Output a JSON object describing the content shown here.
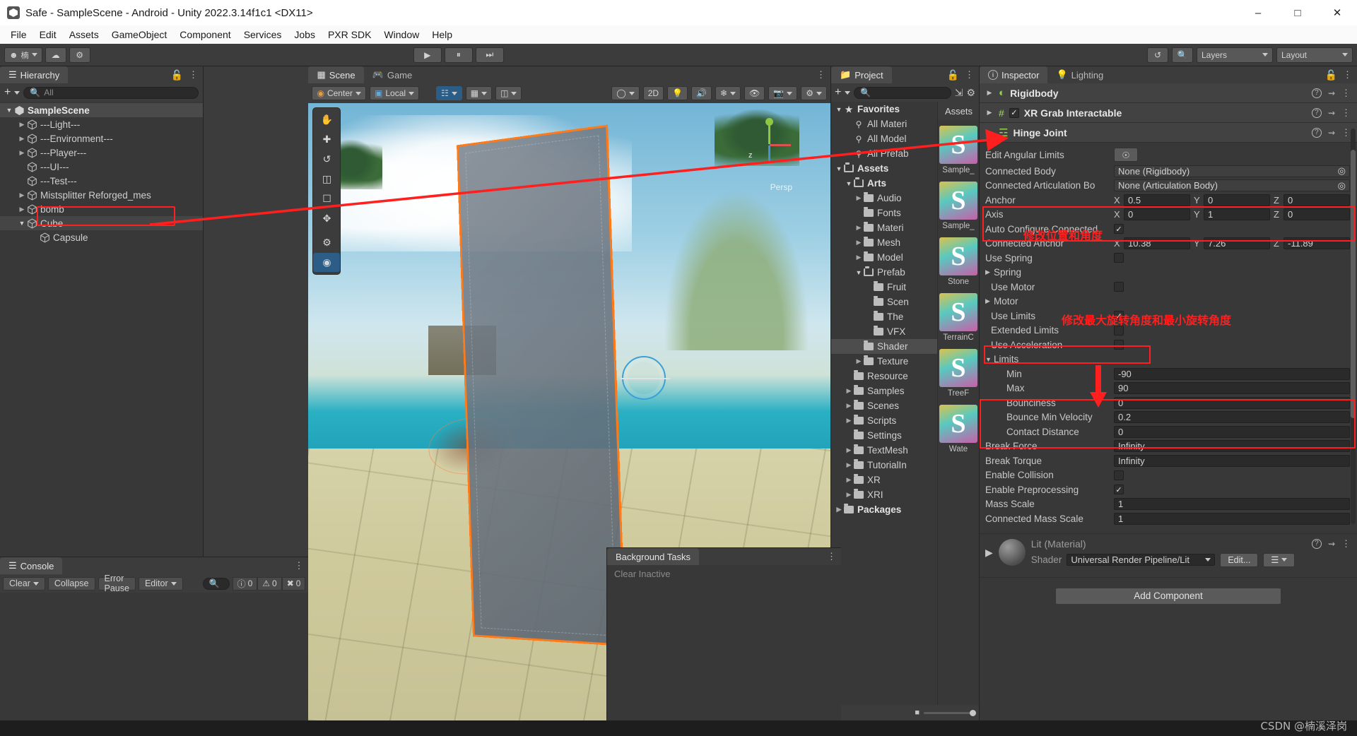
{
  "window": {
    "title": "Safe - SampleScene - Android - Unity 2022.3.14f1c1 <DX11>",
    "minimize": "–",
    "maximize": "□",
    "close": "✕"
  },
  "menubar": [
    "File",
    "Edit",
    "Assets",
    "GameObject",
    "Component",
    "Services",
    "Jobs",
    "PXR SDK",
    "Window",
    "Help"
  ],
  "toolbar": {
    "account_icon": "account-icon",
    "cloud_icon": "cloud-icon",
    "settings_icon": "gear-icon",
    "play": "▶",
    "pause": "⏸",
    "step": "⏭",
    "history_icon": "undo-history-icon",
    "search_icon": "search-icon",
    "layers_label": "Layers",
    "layout_label": "Layout"
  },
  "hierarchy": {
    "tab": "Hierarchy",
    "search_placeholder": "All",
    "items": [
      {
        "label": "SampleScene",
        "depth": 0,
        "arrow": "down",
        "icon": "unity-scene-icon",
        "selected": false,
        "scene": true
      },
      {
        "label": "---Light---",
        "depth": 1,
        "arrow": "right",
        "icon": "gameobject-icon",
        "selected": false
      },
      {
        "label": "---Environment---",
        "depth": 1,
        "arrow": "right",
        "icon": "gameobject-icon",
        "selected": false
      },
      {
        "label": "---Player---",
        "depth": 1,
        "arrow": "right",
        "icon": "gameobject-icon",
        "selected": false
      },
      {
        "label": "---UI---",
        "depth": 1,
        "arrow": "",
        "icon": "gameobject-icon",
        "selected": false
      },
      {
        "label": "---Test---",
        "depth": 1,
        "arrow": "",
        "icon": "gameobject-icon",
        "selected": false
      },
      {
        "label": "Mistsplitter Reforged_mes",
        "depth": 1,
        "arrow": "right",
        "icon": "gameobject-icon",
        "selected": false
      },
      {
        "label": "bomb",
        "depth": 1,
        "arrow": "right",
        "icon": "gameobject-icon",
        "selected": false
      },
      {
        "label": "Cube",
        "depth": 1,
        "arrow": "down",
        "icon": "gameobject-icon",
        "selected": true
      },
      {
        "label": "Capsule",
        "depth": 2,
        "arrow": "",
        "icon": "gameobject-icon",
        "selected": false
      }
    ]
  },
  "scene": {
    "tabs": [
      {
        "label": "Scene",
        "icon": "scene-icon",
        "active": true
      },
      {
        "label": "Game",
        "icon": "game-icon",
        "active": false
      }
    ],
    "pivot_label": "Center",
    "space_label": "Local",
    "mode_2d": "2D",
    "perspective_label": "Persp",
    "axis_x": "x",
    "axis_y": "y",
    "axis_z": "z",
    "tools": [
      "hand-tool",
      "move-tool",
      "rotate-tool",
      "scale-tool",
      "rect-tool",
      "transform-tool",
      "custom-tool",
      "collider-tool"
    ]
  },
  "console": {
    "tab": "Console",
    "clear": "Clear",
    "collapse": "Collapse",
    "error_pause": "Error Pause",
    "editor": "Editor",
    "search_placeholder": "",
    "log_count": "0",
    "warn_count": "0",
    "error_count": "0"
  },
  "background_tasks": {
    "title": "Background Tasks",
    "clear_inactive": "Clear Inactive"
  },
  "project": {
    "tab": "Project",
    "search_placeholder": "",
    "assets_column_header": "Assets",
    "tree": [
      {
        "label": "Favorites",
        "depth": 0,
        "arrow": "down",
        "icon": "star-icon",
        "bold": true
      },
      {
        "label": "All Materi",
        "depth": 1,
        "arrow": "",
        "icon": "search-icon"
      },
      {
        "label": "All Model",
        "depth": 1,
        "arrow": "",
        "icon": "search-icon"
      },
      {
        "label": "All Prefab",
        "depth": 1,
        "arrow": "",
        "icon": "search-icon"
      },
      {
        "label": "Assets",
        "depth": 0,
        "arrow": "down",
        "icon": "folder-open-icon",
        "bold": true
      },
      {
        "label": "Arts",
        "depth": 1,
        "arrow": "down",
        "icon": "folder-open-icon",
        "bold": true
      },
      {
        "label": "Audio",
        "depth": 2,
        "arrow": "right",
        "icon": "folder-icon"
      },
      {
        "label": "Fonts",
        "depth": 2,
        "arrow": "",
        "icon": "folder-icon"
      },
      {
        "label": "Materi",
        "depth": 2,
        "arrow": "right",
        "icon": "folder-icon"
      },
      {
        "label": "Mesh",
        "depth": 2,
        "arrow": "right",
        "icon": "folder-icon"
      },
      {
        "label": "Model",
        "depth": 2,
        "arrow": "right",
        "icon": "folder-icon"
      },
      {
        "label": "Prefab",
        "depth": 2,
        "arrow": "down",
        "icon": "folder-open-icon"
      },
      {
        "label": "Fruit",
        "depth": 3,
        "arrow": "",
        "icon": "folder-icon"
      },
      {
        "label": "Scen",
        "depth": 3,
        "arrow": "",
        "icon": "folder-icon"
      },
      {
        "label": "The",
        "depth": 3,
        "arrow": "",
        "icon": "folder-icon"
      },
      {
        "label": "VFX",
        "depth": 3,
        "arrow": "",
        "icon": "folder-icon"
      },
      {
        "label": "Shader",
        "depth": 2,
        "arrow": "",
        "icon": "folder-icon",
        "selected": true
      },
      {
        "label": "Texture",
        "depth": 2,
        "arrow": "right",
        "icon": "folder-icon"
      },
      {
        "label": "Resource",
        "depth": 1,
        "arrow": "",
        "icon": "folder-icon"
      },
      {
        "label": "Samples",
        "depth": 1,
        "arrow": "right",
        "icon": "folder-icon"
      },
      {
        "label": "Scenes",
        "depth": 1,
        "arrow": "right",
        "icon": "folder-icon"
      },
      {
        "label": "Scripts",
        "depth": 1,
        "arrow": "right",
        "icon": "folder-icon"
      },
      {
        "label": "Settings",
        "depth": 1,
        "arrow": "",
        "icon": "folder-icon"
      },
      {
        "label": "TextMesh",
        "depth": 1,
        "arrow": "right",
        "icon": "folder-icon"
      },
      {
        "label": "TutorialIn",
        "depth": 1,
        "arrow": "right",
        "icon": "folder-icon"
      },
      {
        "label": "XR",
        "depth": 1,
        "arrow": "right",
        "icon": "folder-icon"
      },
      {
        "label": "XRI",
        "depth": 1,
        "arrow": "right",
        "icon": "folder-icon"
      },
      {
        "label": "Packages",
        "depth": 0,
        "arrow": "right",
        "icon": "folder-icon",
        "bold": true
      }
    ],
    "assets": [
      {
        "name": "Sample_",
        "glyph": "S"
      },
      {
        "name": "Sample_",
        "glyph": "S"
      },
      {
        "name": "Stone",
        "glyph": "S"
      },
      {
        "name": "TerrainC",
        "glyph": "S"
      },
      {
        "name": "TreeF",
        "glyph": "S"
      },
      {
        "name": "Wate",
        "glyph": "S"
      }
    ]
  },
  "inspector": {
    "tabs": [
      {
        "label": "Inspector",
        "icon": "info-icon",
        "active": true
      },
      {
        "label": "Lighting",
        "icon": "lightbulb-icon",
        "active": false
      }
    ],
    "components": [
      {
        "name": "Rigidbody",
        "icon": "rigidbody-icon",
        "has_checkbox": false
      },
      {
        "name": "XR Grab Interactable",
        "icon": "script-icon",
        "has_checkbox": true,
        "checked": true
      },
      {
        "name": "Hinge Joint",
        "icon": "hinge-joint-icon",
        "has_checkbox": false
      }
    ],
    "fields": {
      "edit_angular_limits": {
        "label": "Edit Angular Limits",
        "button_icon": "angular-limits-icon"
      },
      "connected_body": {
        "label": "Connected Body",
        "value": "None (Rigidbody)"
      },
      "connected_articulation_body": {
        "label": "Connected Articulation Bo",
        "value": "None (Articulation Body)"
      },
      "anchor": {
        "label": "Anchor",
        "x": "0.5",
        "y": "0",
        "z": "0"
      },
      "axis": {
        "label": "Axis",
        "x": "0",
        "y": "1",
        "z": "0"
      },
      "auto_configure": {
        "label": "Auto Configure Connected",
        "checked": true
      },
      "connected_anchor": {
        "label": "Connected Anchor",
        "x": "10.38",
        "y": "7.26",
        "z": "-11.89"
      },
      "use_spring": {
        "label": "Use Spring",
        "checked": false
      },
      "spring": {
        "label": "Spring"
      },
      "use_motor": {
        "label": "Use Motor",
        "checked": false
      },
      "motor": {
        "label": "Motor"
      },
      "use_limits": {
        "label": "Use Limits",
        "checked": true
      },
      "extended_limits": {
        "label": "Extended Limits",
        "checked": false
      },
      "use_acceleration": {
        "label": "Use Acceleration",
        "checked": false
      },
      "limits": {
        "label": "Limits"
      },
      "min": {
        "label": "Min",
        "value": "-90"
      },
      "max": {
        "label": "Max",
        "value": "90"
      },
      "bounciness": {
        "label": "Bounciness",
        "value": "0"
      },
      "bounce_min_velocity": {
        "label": "Bounce Min Velocity",
        "value": "0.2"
      },
      "contact_distance": {
        "label": "Contact Distance",
        "value": "0"
      },
      "break_force": {
        "label": "Break Force",
        "value": "Infinity"
      },
      "break_torque": {
        "label": "Break Torque",
        "value": "Infinity"
      },
      "enable_collision": {
        "label": "Enable Collision",
        "checked": false
      },
      "enable_preprocessing": {
        "label": "Enable Preprocessing",
        "checked": true
      },
      "mass_scale": {
        "label": "Mass Scale",
        "value": "1"
      },
      "connected_mass_scale": {
        "label": "Connected Mass Scale",
        "value": "1"
      }
    },
    "material": {
      "title": "Lit (Material)",
      "shader_label": "Shader",
      "shader_value": "Universal Render Pipeline/Lit",
      "edit_button": "Edit..."
    },
    "add_component": "Add Component"
  },
  "annotations": {
    "anchor_axis_note": "修改位置和角度",
    "limits_note": "修改最大旋转角度和最小旋转角度",
    "accent_color": "#ff1f1f"
  },
  "watermark": "CSDN @楠溪泽岗"
}
